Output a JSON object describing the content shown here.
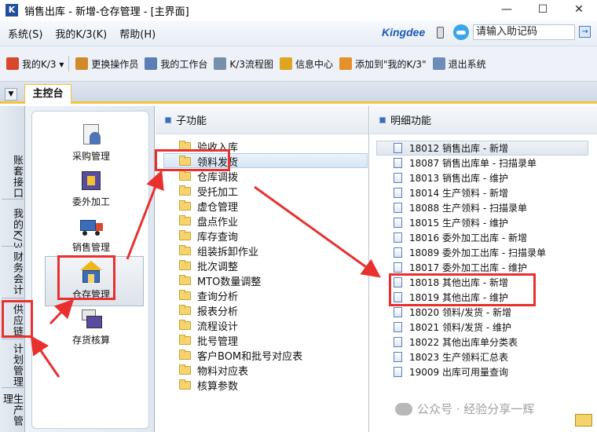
{
  "window": {
    "title": "销售出库 - 新增-仓存管理 - [主界面]",
    "app_icon_text": "K",
    "controls": [
      "—",
      "☐",
      "✕"
    ]
  },
  "menubar": {
    "items": [
      "系统(S)",
      "我的K/3(K)",
      "帮助(H)"
    ],
    "brand": "Kingdee",
    "search_placeholder": "请输入助记码",
    "go_label": "→"
  },
  "toolbar": {
    "items": [
      {
        "label": "我的K/3 ▾",
        "color": "#d9482b"
      },
      {
        "label": "更换操作员",
        "color": "#d08a2a"
      },
      {
        "label": "我的工作台",
        "color": "#5a7fb5"
      },
      {
        "label": "K/3流程图",
        "color": "#7a8fa8"
      },
      {
        "label": "信息中心",
        "color": "#e0a51e"
      },
      {
        "label": "添加到\"我的K/3\"",
        "color": "#e5902a"
      },
      {
        "label": "退出系统",
        "color": "#6d8db8"
      }
    ]
  },
  "tabs": {
    "main": "主控台"
  },
  "vtabs": [
    {
      "label": "账套接口"
    },
    {
      "label": "我的K/3"
    },
    {
      "label": "财务会计"
    },
    {
      "label": "供应链"
    },
    {
      "label": "计划管理"
    },
    {
      "label": "生产管理"
    }
  ],
  "modules": [
    {
      "label": "采购管理",
      "icon": "purchase-icon"
    },
    {
      "label": "委外加工",
      "icon": "outsourcing-icon"
    },
    {
      "label": "销售管理",
      "icon": "sales-truck-icon"
    },
    {
      "label": "仓存管理",
      "icon": "warehouse-icon"
    },
    {
      "label": "存货核算",
      "icon": "inventory-accounting-icon"
    }
  ],
  "sub_panel": {
    "title": "子功能",
    "items": [
      "验收入库",
      "领料发货",
      "仓库调拨",
      "受托加工",
      "虚仓管理",
      "盘点作业",
      "库存查询",
      "组装拆卸作业",
      "批次调整",
      "MTO数量调整",
      "查询分析",
      "报表分析",
      "流程设计",
      "批号管理",
      "客户BOM和批号对应表",
      "物料对应表",
      "核算参数"
    ],
    "selected": "领料发货"
  },
  "detail_panel": {
    "title": "明细功能",
    "items": [
      {
        "code": "18012",
        "name": "销售出库 - 新增"
      },
      {
        "code": "18087",
        "name": "销售出库单 - 扫描录单"
      },
      {
        "code": "18013",
        "name": "销售出库 - 维护"
      },
      {
        "code": "18014",
        "name": "生产领料 - 新增"
      },
      {
        "code": "18088",
        "name": "生产领料 - 扫描录单"
      },
      {
        "code": "18015",
        "name": "生产领料 - 维护"
      },
      {
        "code": "18016",
        "name": "委外加工出库 - 新增"
      },
      {
        "code": "18089",
        "name": "委外加工出库 - 扫描录单"
      },
      {
        "code": "18017",
        "name": "委外加工出库 - 维护"
      },
      {
        "code": "18018",
        "name": "其他出库 - 新增"
      },
      {
        "code": "18019",
        "name": "其他出库 - 维护"
      },
      {
        "code": "18020",
        "name": "领料/发货 - 新增"
      },
      {
        "code": "18021",
        "name": "领料/发货 - 维护"
      },
      {
        "code": "18022",
        "name": "其他出库单分类表"
      },
      {
        "code": "18023",
        "name": "生产领料汇总表"
      },
      {
        "code": "19009",
        "name": "出库可用量查询"
      }
    ]
  },
  "watermark": "公众号 · 经验分享一辉"
}
